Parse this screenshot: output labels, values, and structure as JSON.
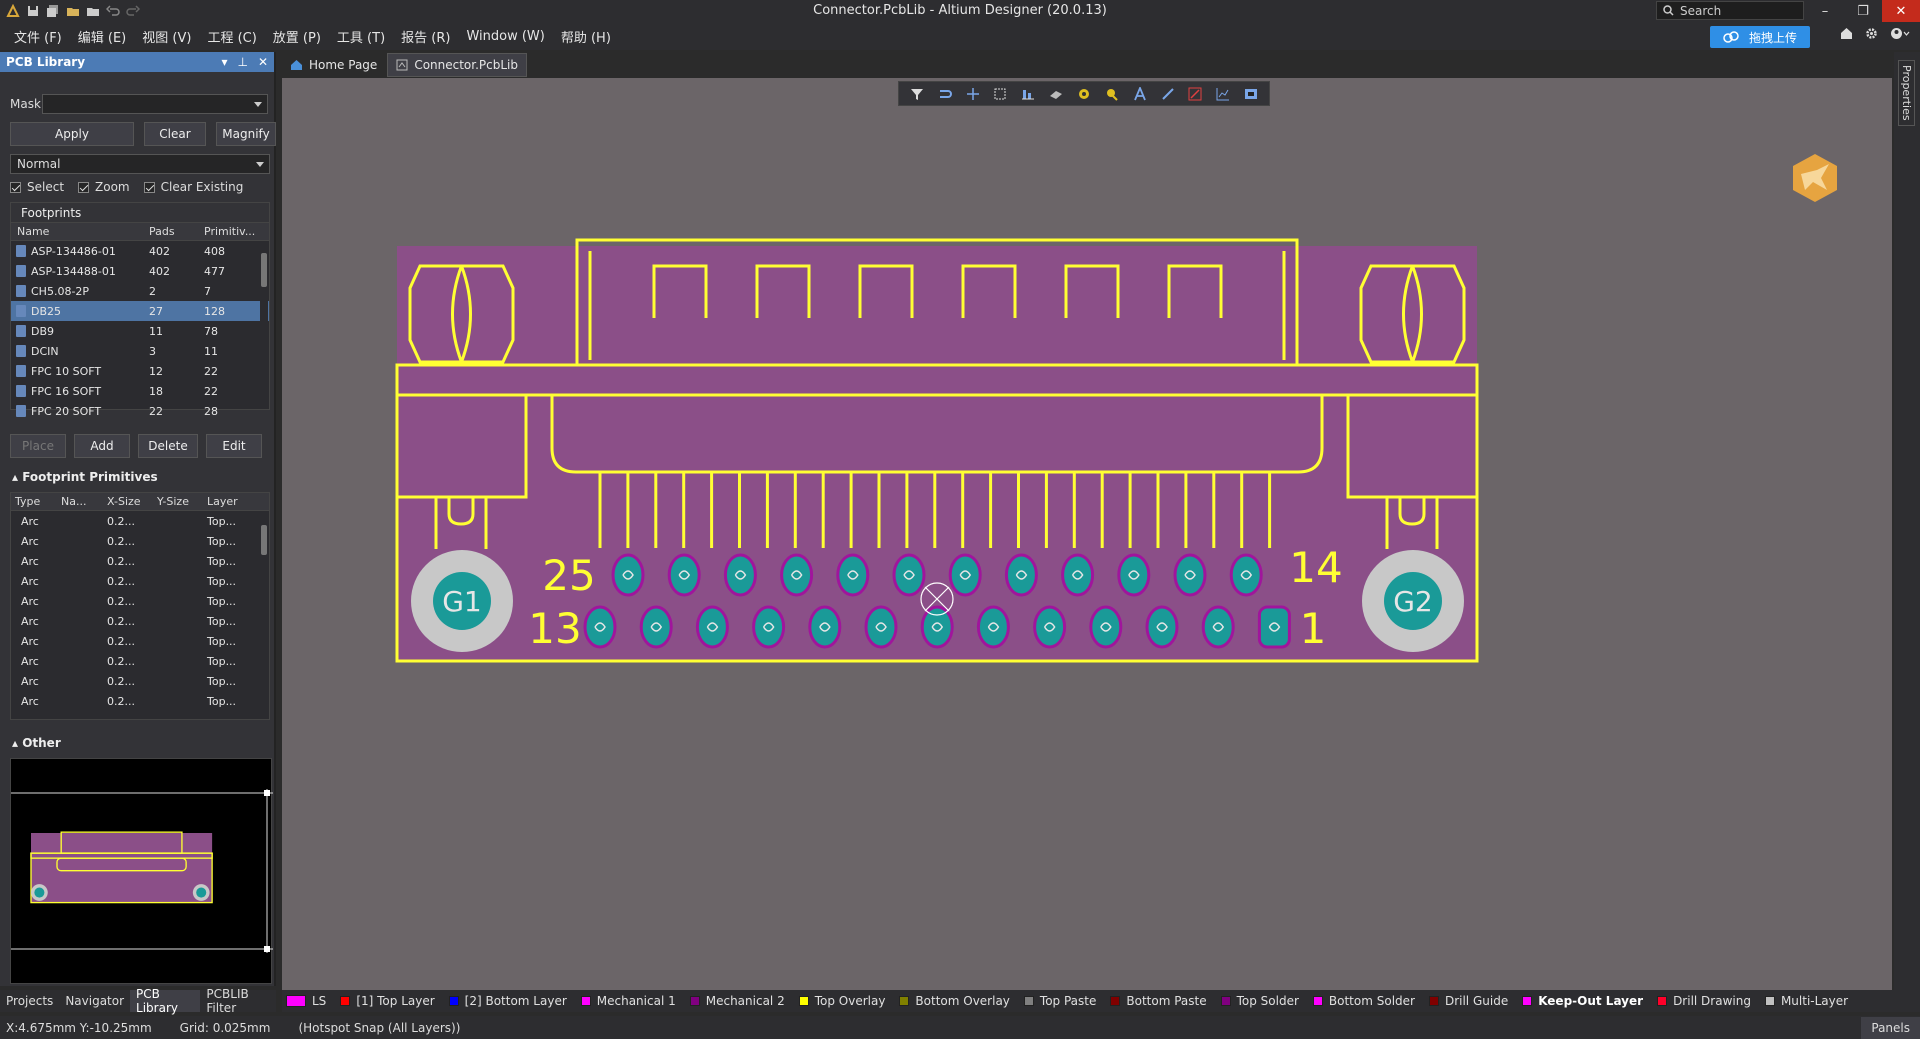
{
  "window": {
    "title": "Connector.PcbLib - Altium Designer (20.0.13)",
    "search_placeholder": "Search",
    "buttons": [
      "–",
      "❐",
      "✕"
    ]
  },
  "menu": {
    "items": [
      "文件 (F)",
      "编辑 (E)",
      "视图 (V)",
      "工程 (C)",
      "放置 (P)",
      "工具 (T)",
      "报告 (R)",
      "Window (W)",
      "帮助 (H)"
    ],
    "upload_button": "拖拽上传"
  },
  "panel": {
    "title": "PCB Library",
    "mask_label": "Mask",
    "mask_value": "",
    "apply": "Apply",
    "clear": "Clear",
    "magnify": "Magnify",
    "mode": "Normal",
    "checks": [
      "Select",
      "Zoom",
      "Clear Existing"
    ],
    "footprints_label": "Footprints",
    "fp_columns": [
      "Name",
      "Pads",
      "Primitiv..."
    ],
    "footprints": [
      {
        "name": "ASP-134486-01",
        "pads": "402",
        "prims": "408"
      },
      {
        "name": "ASP-134488-01",
        "pads": "402",
        "prims": "477"
      },
      {
        "name": "CH5.08-2P",
        "pads": "2",
        "prims": "7"
      },
      {
        "name": "DB25",
        "pads": "27",
        "prims": "128"
      },
      {
        "name": "DB9",
        "pads": "11",
        "prims": "78"
      },
      {
        "name": "DCIN",
        "pads": "3",
        "prims": "11"
      },
      {
        "name": "FPC 10 SOFT",
        "pads": "12",
        "prims": "22"
      },
      {
        "name": "FPC 16 SOFT",
        "pads": "18",
        "prims": "22"
      },
      {
        "name": "FPC 20 SOFT",
        "pads": "22",
        "prims": "28"
      }
    ],
    "selected_footprint": "DB25",
    "fp_buttons": [
      "Place",
      "Add",
      "Delete",
      "Edit"
    ],
    "primitives_label": "Footprint Primitives",
    "prim_columns": [
      "Type",
      "Na...",
      "X-Size",
      "Y-Size",
      "Layer"
    ],
    "primitives": [
      {
        "type": "Arc",
        "x": "0.2...",
        "layer": "Top..."
      },
      {
        "type": "Arc",
        "x": "0.2...",
        "layer": "Top..."
      },
      {
        "type": "Arc",
        "x": "0.2...",
        "layer": "Top..."
      },
      {
        "type": "Arc",
        "x": "0.2...",
        "layer": "Top..."
      },
      {
        "type": "Arc",
        "x": "0.2...",
        "layer": "Top..."
      },
      {
        "type": "Arc",
        "x": "0.2...",
        "layer": "Top..."
      },
      {
        "type": "Arc",
        "x": "0.2...",
        "layer": "Top..."
      },
      {
        "type": "Arc",
        "x": "0.2...",
        "layer": "Top..."
      },
      {
        "type": "Arc",
        "x": "0.2...",
        "layer": "Top..."
      },
      {
        "type": "Arc",
        "x": "0.2...",
        "layer": "Top..."
      }
    ],
    "other_label": "Other",
    "bottom_tabs": [
      "Projects",
      "Navigator",
      "PCB Library",
      "PCBLIB Filter"
    ],
    "active_bottom_tab": "PCB Library"
  },
  "doc_tabs": [
    "Home Page",
    "Connector.PcbLib"
  ],
  "active_doc_tab": "Connector.PcbLib",
  "pcb": {
    "labels": {
      "g1": "G1",
      "g2": "G2",
      "n25": "25",
      "n13": "13",
      "n14": "14",
      "n1": "1"
    },
    "colors": {
      "board": "#8b4f88",
      "outline": "#ffff33",
      "pad": "#1a9a98",
      "pad_ring": "#a0159c",
      "mount_outer": "#c8c8c8"
    }
  },
  "side_tab": "Properties",
  "layers": [
    {
      "name": "LS",
      "color": "#ff00ff"
    },
    {
      "name": "[1] Top Layer",
      "color": "#ff0000"
    },
    {
      "name": "[2] Bottom Layer",
      "color": "#0000ff"
    },
    {
      "name": "Mechanical 1",
      "color": "#ff00ff"
    },
    {
      "name": "Mechanical 2",
      "color": "#800080"
    },
    {
      "name": "Top Overlay",
      "color": "#ffff00"
    },
    {
      "name": "Bottom Overlay",
      "color": "#808000"
    },
    {
      "name": "Top Paste",
      "color": "#808080"
    },
    {
      "name": "Bottom Paste",
      "color": "#800000"
    },
    {
      "name": "Top Solder",
      "color": "#800080"
    },
    {
      "name": "Bottom Solder",
      "color": "#ff00ff"
    },
    {
      "name": "Drill Guide",
      "color": "#800000"
    },
    {
      "name": "Keep-Out Layer",
      "color": "#ff00ff"
    },
    {
      "name": "Drill Drawing",
      "color": "#ff002a"
    },
    {
      "name": "Multi-Layer",
      "color": "#c0c0c0"
    }
  ],
  "active_layer": "Keep-Out Layer",
  "status": {
    "coords": "X:4.675mm Y:-10.25mm",
    "grid": "Grid: 0.025mm",
    "snap": "(Hotspot Snap (All Layers))",
    "panels": "Panels"
  }
}
